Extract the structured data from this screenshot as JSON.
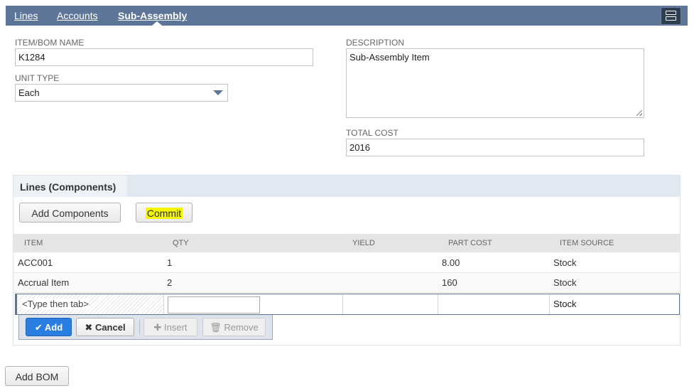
{
  "tabs": {
    "lines": "Lines",
    "accounts": "Accounts",
    "sub_assembly": "Sub-Assembly"
  },
  "form": {
    "item_name_label": "ITEM/BOM NAME",
    "item_name_value": "K1284",
    "unit_type_label": "UNIT TYPE",
    "unit_type_value": "Each",
    "description_label": "DESCRIPTION",
    "description_value": "Sub-Assembly Item",
    "total_cost_label": "TOTAL COST",
    "total_cost_value": "2016"
  },
  "sublist": {
    "tab_label": "Lines (Components)",
    "add_components_label": "Add Components",
    "commit_label": "Commit",
    "columns": [
      "ITEM",
      "QTY",
      "YIELD",
      "PART COST",
      "ITEM SOURCE"
    ],
    "rows": [
      {
        "item": "ACC001",
        "qty": "1",
        "yield": "",
        "part_cost": "8.00",
        "item_source": "Stock"
      },
      {
        "item": "Accrual Item",
        "qty": "2",
        "yield": "",
        "part_cost": "160",
        "item_source": "Stock"
      }
    ],
    "edit_row": {
      "item_placeholder": "<Type then tab>",
      "item_source": "Stock"
    },
    "actions": {
      "add": "Add",
      "cancel": "Cancel",
      "insert": "Insert",
      "remove": "Remove"
    }
  },
  "footer": {
    "add_bom_label": "Add BOM"
  },
  "colors": {
    "tabbar": "#5c7599",
    "primary_button": "#2a7de1",
    "commit_highlight": "#f3f600"
  }
}
